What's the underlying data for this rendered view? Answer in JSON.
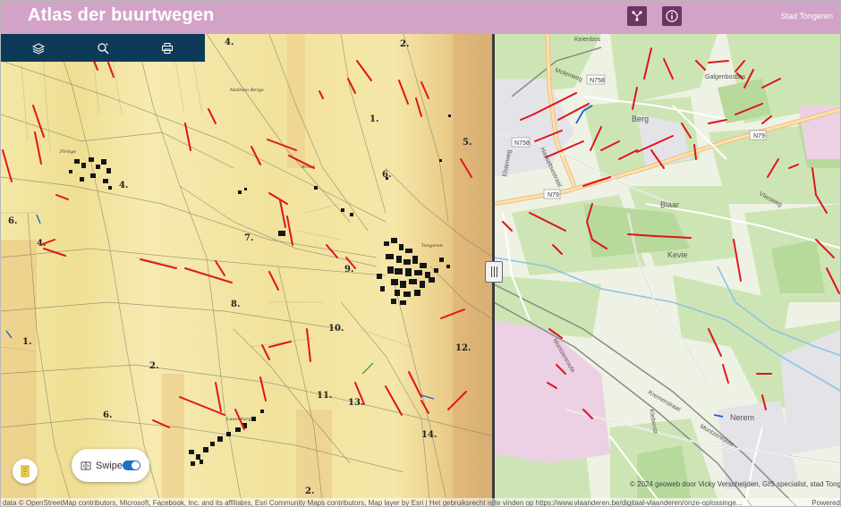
{
  "header": {
    "title": "Atlas der buurtwegen",
    "org": "Stad Tongeren",
    "buttons": [
      {
        "icon": "share-icon"
      },
      {
        "icon": "info-icon"
      }
    ]
  },
  "toolbar": {
    "tools": [
      {
        "icon": "layers-icon"
      },
      {
        "icon": "search-icon"
      },
      {
        "icon": "print-icon"
      }
    ]
  },
  "swipe": {
    "label": "Swipe",
    "enabled": true
  },
  "map_labels": {
    "places": [
      "Berg",
      "Blaar",
      "Kevie",
      "Nerem",
      "Keienbos",
      "Galgenbosbos"
    ],
    "roads": [
      "Molenweg",
      "Elsterweg",
      "Vliesweg",
      "Montzenroute",
      "Kremerstraat",
      "Hasseltsestraat",
      "Kleberstr.",
      "Montzenroute"
    ],
    "road_numbers": [
      "N758",
      "N758",
      "N79",
      "N79"
    ],
    "parcels": [
      "4.",
      "4.",
      "3.",
      "2.",
      "1.",
      "5.",
      "6.",
      "7.",
      "8.",
      "9.",
      "10.",
      "11.",
      "12.",
      "13.",
      "14.",
      "6.",
      "6.",
      "4.",
      "1.",
      "2.",
      "3."
    ]
  },
  "credits": {
    "left": "data © OpenStreetMap contributors, Microsoft, Facebook, Inc. and its affiliates, Esri Community Maps contributors, Map layer by Esri | Het gebruiksrecht is te vinden op https://www.vlaanderen.be/digitaal-vlaanderen/onze-oplossinge...",
    "made_by": "© 2024 geoweb door Vicky Verscheijden, GIS specialist, stad Tongeren",
    "powered": "Powered"
  },
  "colors": {
    "header_bg": "#d3a3c7",
    "header_btn": "#6b3660",
    "toolbar_bg": "#0d3a59",
    "old_map_bg": "#f3e7a4",
    "modern_map_bg": "#eef3e4",
    "path_red": "#e0141e",
    "path_blue": "#2060d0",
    "toggle_blue": "#1a73c8"
  }
}
